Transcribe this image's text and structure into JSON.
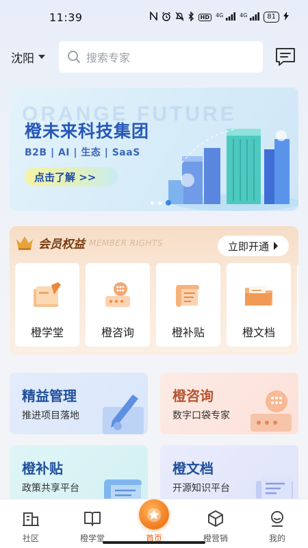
{
  "status_bar": {
    "time": "11:39",
    "network_1": "4G",
    "network_2": "4G",
    "hd": "HD",
    "battery": "81"
  },
  "header": {
    "city": "沈阳",
    "search_placeholder": "搜索专家"
  },
  "banner": {
    "watermark": "ORANGE FUTURE",
    "title": "橙未来科技集团",
    "subtitle": "B2B | AI | 生态 | SaaS",
    "cta": "点击了解 >>",
    "slide_count": 3,
    "active_slide": 3
  },
  "member": {
    "title": "会员权益",
    "subtitle": "MEMBER RIGHTS",
    "open_button": "立即开通",
    "tiles": [
      {
        "label": "橙学堂",
        "icon": "book-pen-icon"
      },
      {
        "label": "橙咨询",
        "icon": "phone-dial-icon"
      },
      {
        "label": "橙补贴",
        "icon": "scroll-icon"
      },
      {
        "label": "橙文档",
        "icon": "folder-icon"
      }
    ]
  },
  "features": [
    {
      "title": "精益管理",
      "subtitle": "推进项目落地",
      "icon": "pen-card-icon"
    },
    {
      "title": "橙咨询",
      "subtitle": "数字口袋专家",
      "icon": "phone-dial-icon"
    },
    {
      "title": "橙补贴",
      "subtitle": "政策共享平台",
      "icon": "scroll-icon"
    },
    {
      "title": "橙文档",
      "subtitle": "开源知识平台",
      "icon": "document-icon"
    }
  ],
  "tabbar": [
    {
      "label": "社区",
      "icon": "community-icon"
    },
    {
      "label": "橙学堂",
      "icon": "book-icon"
    },
    {
      "label": "首页",
      "icon": "medal-star-icon",
      "active": true
    },
    {
      "label": "橙营销",
      "icon": "cube-icon"
    },
    {
      "label": "我的",
      "icon": "profile-icon"
    }
  ],
  "colors": {
    "accent": "#e8590c",
    "banner_title": "#2758b8",
    "member_title": "#7a3b11"
  }
}
